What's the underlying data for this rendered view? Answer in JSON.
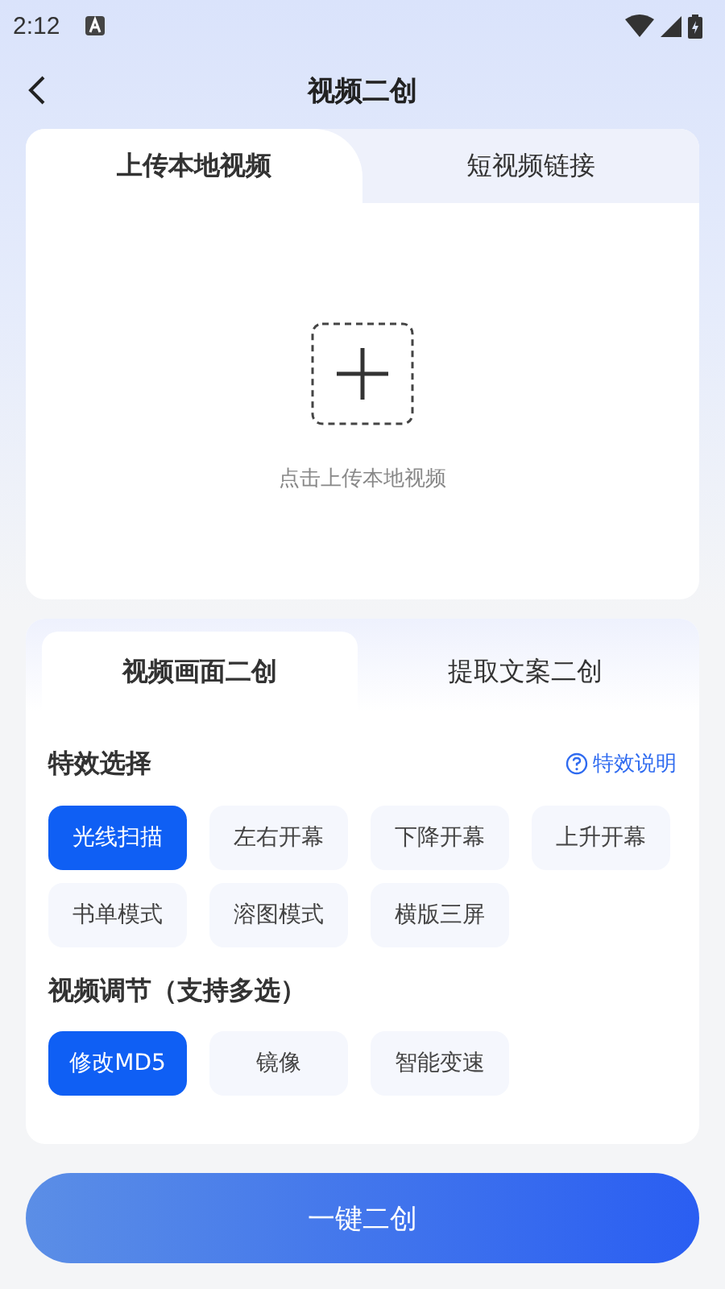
{
  "status_bar": {
    "time": "2:12"
  },
  "header": {
    "title": "视频二创"
  },
  "source_tabs": [
    {
      "label": "上传本地视频",
      "selected": true
    },
    {
      "label": "短视频链接",
      "selected": false
    }
  ],
  "upload": {
    "hint": "点击上传本地视频"
  },
  "mode_tabs": [
    {
      "label": "视频画面二创",
      "selected": true
    },
    {
      "label": "提取文案二创",
      "selected": false
    }
  ],
  "effects": {
    "title": "特效选择",
    "help": "特效说明",
    "options": [
      {
        "label": "光线扫描",
        "selected": true
      },
      {
        "label": "左右开幕",
        "selected": false
      },
      {
        "label": "下降开幕",
        "selected": false
      },
      {
        "label": "上升开幕",
        "selected": false
      },
      {
        "label": "书单模式",
        "selected": false
      },
      {
        "label": "溶图模式",
        "selected": false
      },
      {
        "label": "横版三屏",
        "selected": false
      }
    ]
  },
  "adjust": {
    "title": "视频调节（支持多选）",
    "options": [
      {
        "label": "修改MD5",
        "selected": true
      },
      {
        "label": "镜像",
        "selected": false
      },
      {
        "label": "智能变速",
        "selected": false
      }
    ]
  },
  "primary_button": "一键二创"
}
